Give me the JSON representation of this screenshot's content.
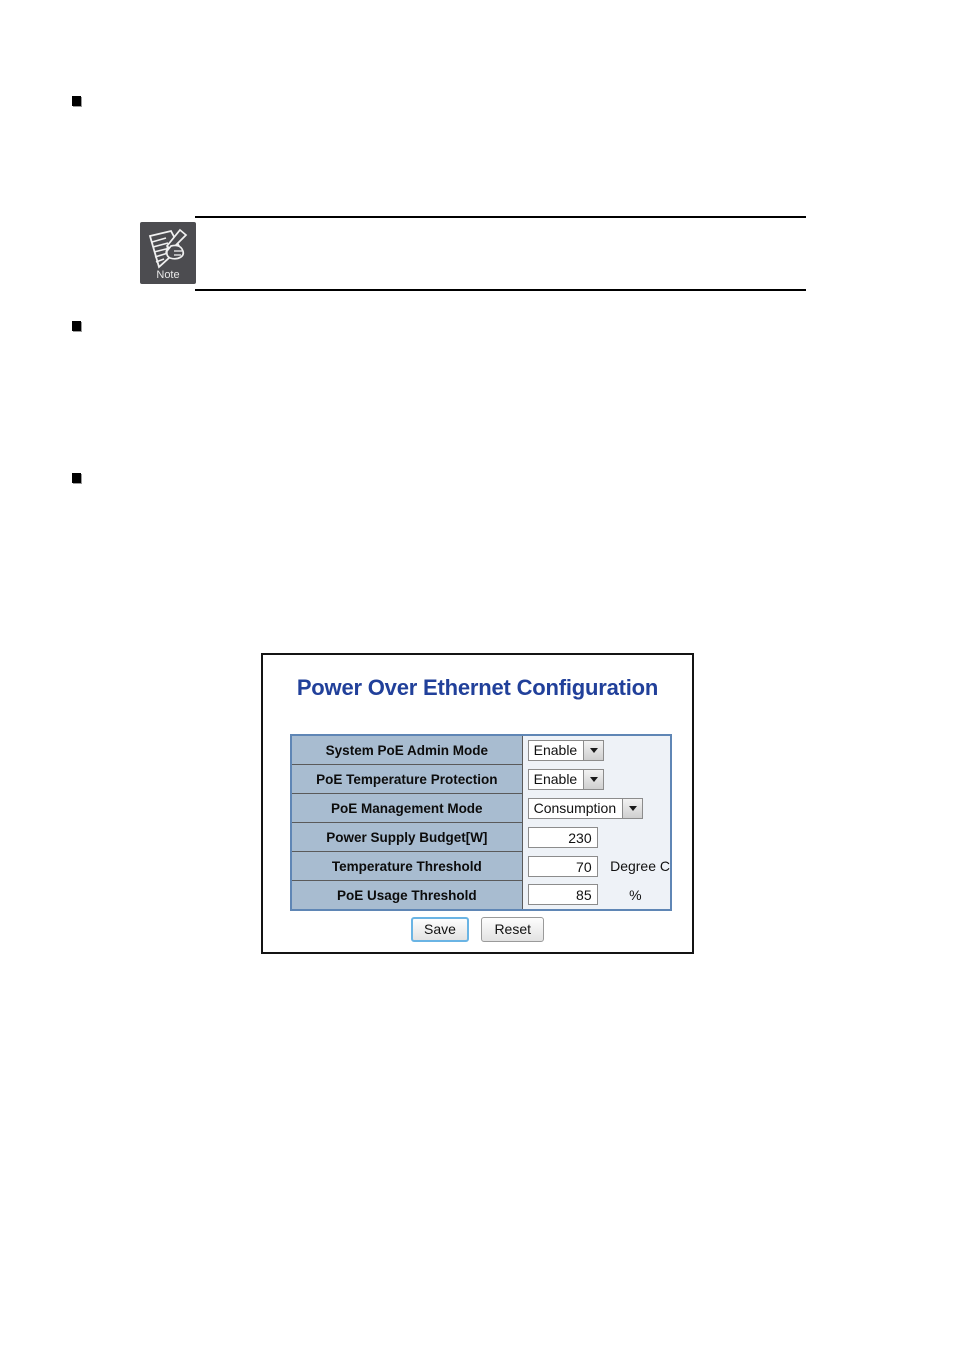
{
  "page": {
    "bullets": [
      {
        "id": "bullet-1"
      },
      {
        "id": "bullet-2"
      },
      {
        "id": "bullet-3"
      }
    ]
  },
  "note": {
    "icon_label": "Note",
    "icon_name": "note-pen-paper-icon"
  },
  "poe_panel": {
    "title": "Power Over Ethernet Configuration",
    "rows": [
      {
        "label": "System PoE Admin Mode",
        "control": "select",
        "value": "Enable",
        "unit": ""
      },
      {
        "label": "PoE Temperature Protection",
        "control": "select",
        "value": "Enable",
        "unit": ""
      },
      {
        "label": "PoE Management Mode",
        "control": "select",
        "value": "Consumption",
        "unit": ""
      },
      {
        "label": "Power Supply Budget[W]",
        "control": "input",
        "value": "230",
        "unit": ""
      },
      {
        "label": "Temperature Threshold",
        "control": "input",
        "value": "70",
        "unit": "Degree C"
      },
      {
        "label": "PoE Usage Threshold",
        "control": "input",
        "value": "85",
        "unit": "%"
      }
    ],
    "buttons": {
      "save": "Save",
      "reset": "Reset"
    },
    "colors": {
      "title": "#21409a",
      "label_bg": "#a8bcd0",
      "table_border": "#5f86b5",
      "panel_border": "#141414",
      "focus_border": "#6ab4e4"
    }
  }
}
